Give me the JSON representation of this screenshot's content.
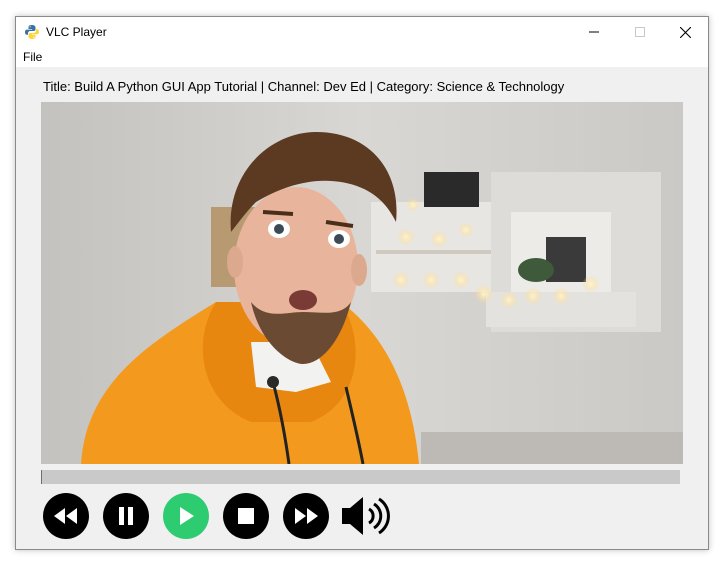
{
  "window": {
    "title": "VLC Player",
    "icon": "python-icon"
  },
  "menu": {
    "file_label": "File"
  },
  "info": {
    "text": "Title: Build A Python GUI App Tutorial | Channel: Dev Ed | Category: Science & Technology"
  },
  "player": {
    "progress": 0.0
  },
  "controls": {
    "rewind_icon": "rewind-icon",
    "pause_icon": "pause-icon",
    "play_icon": "play-icon",
    "stop_icon": "stop-icon",
    "fast_forward_icon": "fast-forward-icon",
    "volume_icon": "volume-icon"
  },
  "colors": {
    "play_button": "#2ecc71",
    "control_button": "#000000",
    "progress_track": "#c9c9c9"
  }
}
